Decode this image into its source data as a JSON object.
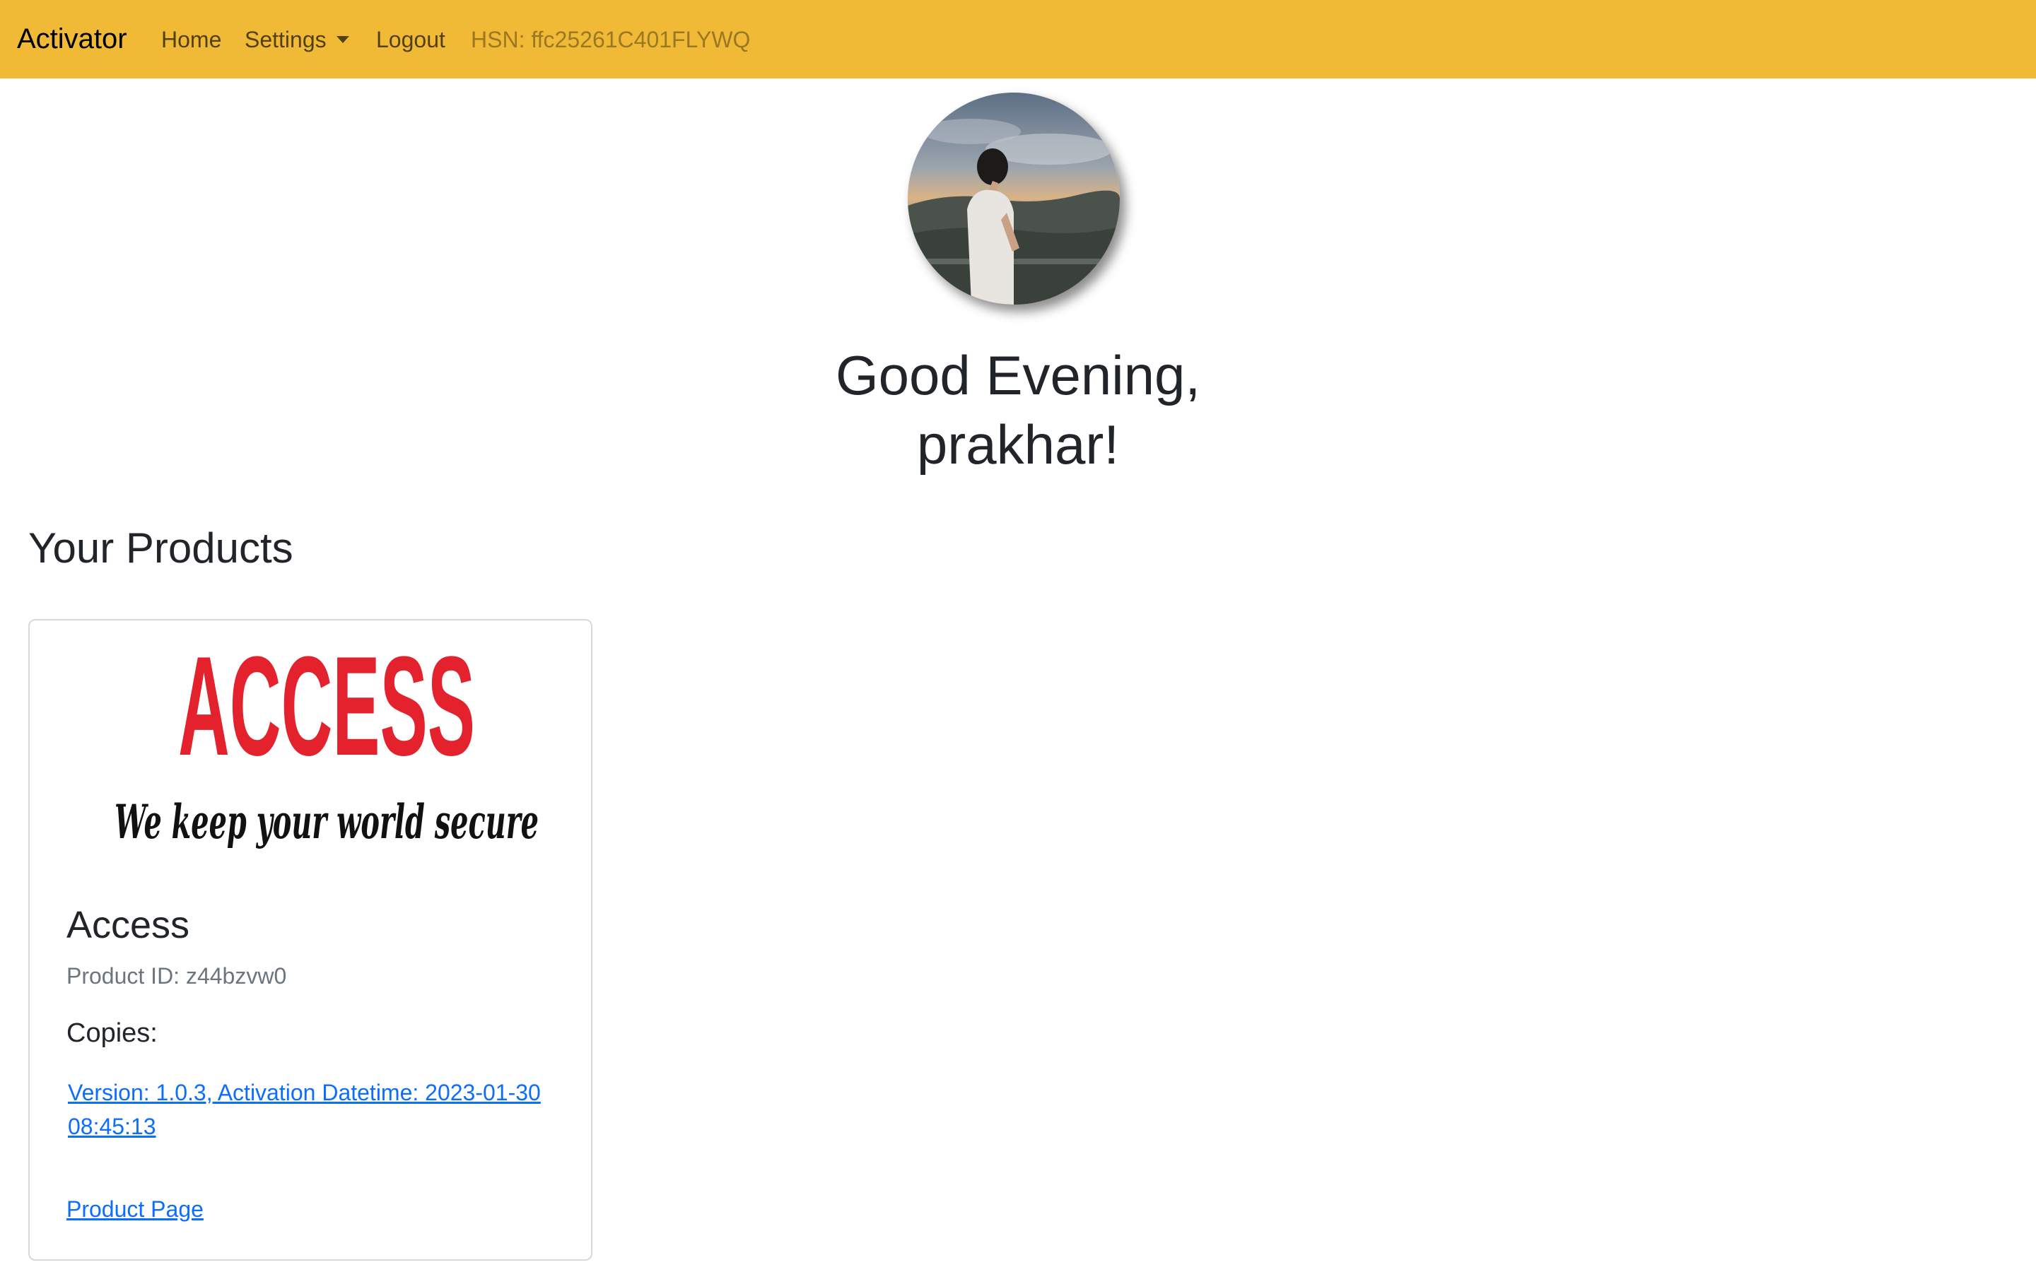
{
  "navbar": {
    "brand": "Activator",
    "home": "Home",
    "settings": "Settings",
    "logout": "Logout",
    "hsn": "HSN: ffc25261C401FLYWQ",
    "background_color": "#f1ba36"
  },
  "profile": {
    "greeting_line1": "Good Evening,",
    "greeting_line2": "prakhar!"
  },
  "products_section": {
    "title": "Your Products",
    "products": [
      {
        "logo_word": "ACCESS",
        "logo_tagline": "We keep your world secure",
        "name": "Access",
        "product_id": "Product ID: z44bzvw0",
        "copies_label": "Copies:",
        "copies": [
          "Version: 1.0.3, Activation Datetime: 2023-01-30 08:45:13"
        ],
        "product_page_label": "Product Page"
      }
    ]
  },
  "colors": {
    "link": "#0d6efd",
    "muted": "#6c757d",
    "logo_red": "#e3222d"
  }
}
